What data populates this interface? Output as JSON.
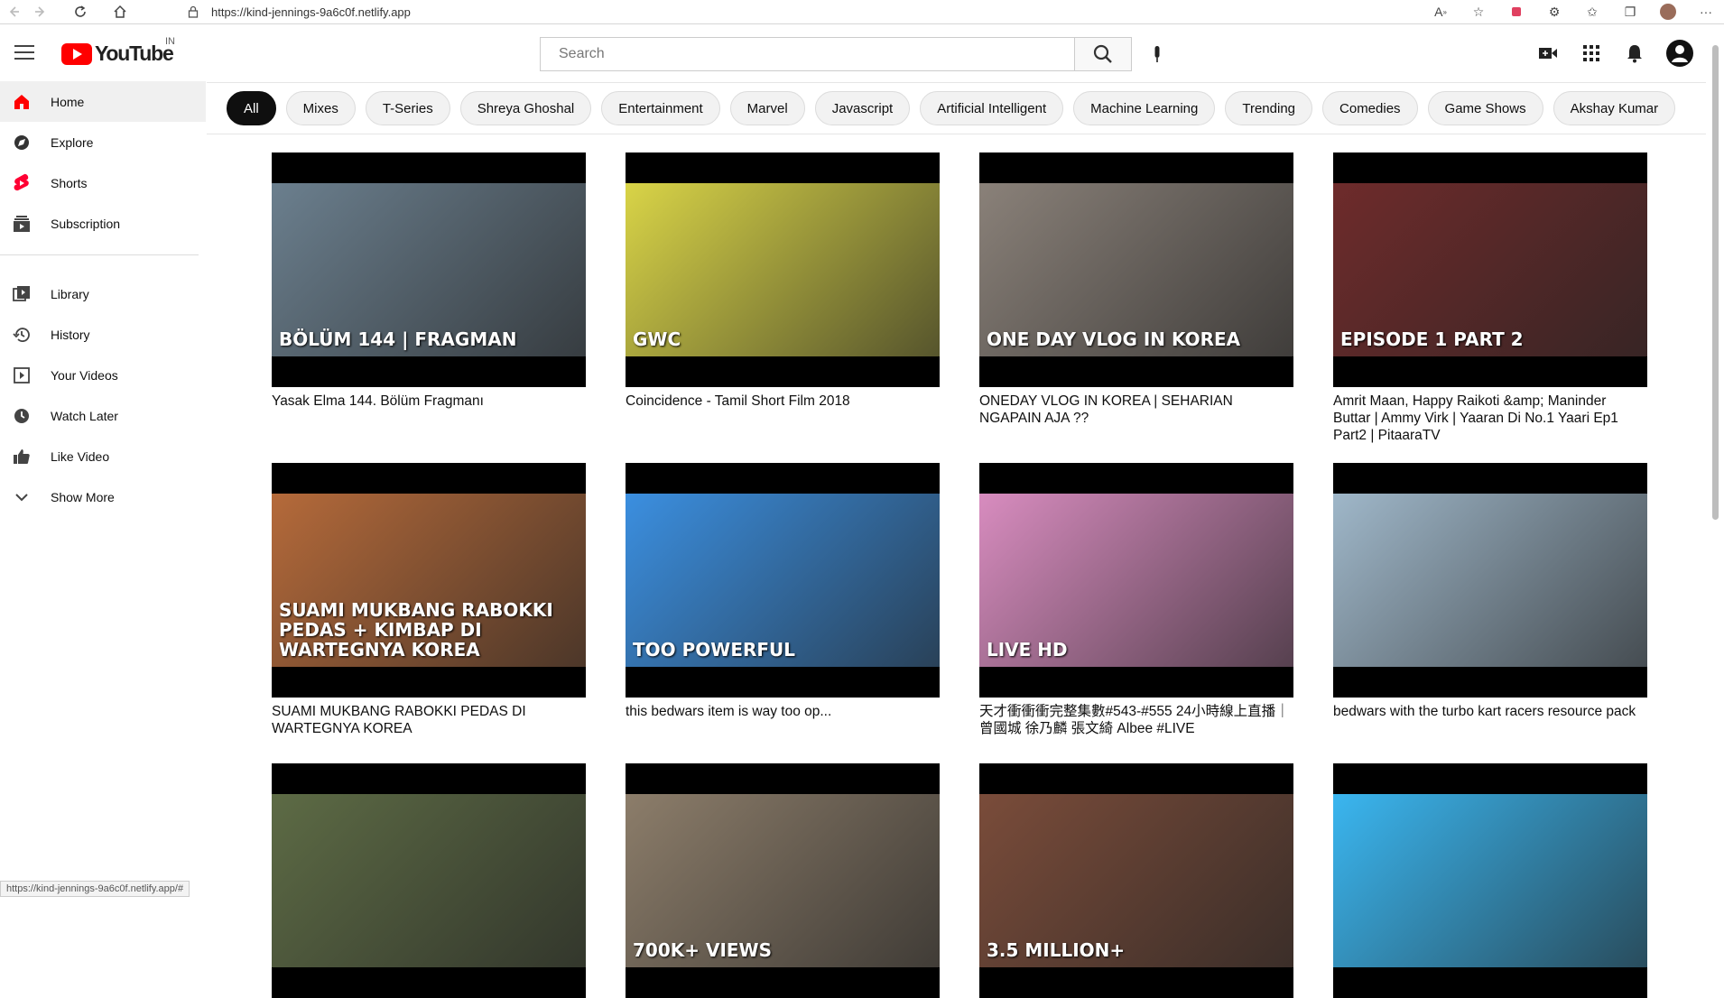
{
  "browser": {
    "url": "https://kind-jennings-9a6c0f.netlify.app",
    "status_url": "https://kind-jennings-9a6c0f.netlify.app/#"
  },
  "header": {
    "logo_text": "YouTube",
    "region": "IN",
    "search_placeholder": "Search"
  },
  "sidebar": {
    "primary": [
      {
        "label": "Home",
        "icon": "home-icon"
      },
      {
        "label": "Explore",
        "icon": "compass-icon"
      },
      {
        "label": "Shorts",
        "icon": "shorts-icon"
      },
      {
        "label": "Subscription",
        "icon": "subscriptions-icon"
      }
    ],
    "secondary": [
      {
        "label": "Library",
        "icon": "library-icon"
      },
      {
        "label": "History",
        "icon": "history-icon"
      },
      {
        "label": "Your Videos",
        "icon": "your-videos-icon"
      },
      {
        "label": "Watch Later",
        "icon": "clock-icon"
      },
      {
        "label": "Like Video",
        "icon": "thumbs-up-icon"
      },
      {
        "label": "Show More",
        "icon": "chevron-down-icon"
      }
    ]
  },
  "chips": [
    "All",
    "Mixes",
    "T-Series",
    "Shreya Ghoshal",
    "Entertainment",
    "Marvel",
    "Javascript",
    "Artificial Intelligent",
    "Machine Learning",
    "Trending",
    "Comedies",
    "Game Shows",
    "Akshay Kumar"
  ],
  "videos": [
    {
      "title": "Yasak Elma 144. Bölüm Fragmanı",
      "overlay": "BÖLÜM 144 | FRAGMAN",
      "color": "#6b7f8e"
    },
    {
      "title": "Coincidence - Tamil Short Film 2018",
      "overlay": "GWC",
      "color": "#d9d447"
    },
    {
      "title": "ONEDAY VLOG IN KOREA | SEHARIAN NGAPAIN AJA ??",
      "overlay": "ONE DAY VLOG IN KOREA",
      "color": "#8a8179"
    },
    {
      "title": "Amrit Maan, Happy Raikoti &amp; Maninder Buttar | Ammy Virk | Yaaran Di No.1 Yaari Ep1 Part2 | PitaaraTV",
      "overlay": "EPISODE 1 PART 2",
      "color": "#6e2b2b"
    },
    {
      "title": "SUAMI MUKBANG RABOKKI PEDAS DI WARTEGNYA KOREA",
      "overlay": "SUAMI MUKBANG RABOKKI PEDAS + KIMBAP DI WARTEGNYA KOREA",
      "color": "#b56a3a"
    },
    {
      "title": "this bedwars item is way too op...",
      "overlay": "TOO POWERFUL",
      "color": "#3b8fe0"
    },
    {
      "title": "天才衝衝衝完整集數#543-#555 24小時線上直播｜曾國城 徐乃麟 張文綺 Albee #LIVE",
      "overlay": "LIVE HD",
      "color": "#d88cbf"
    },
    {
      "title": "bedwars with the turbo kart racers resource pack",
      "overlay": "",
      "color": "#9fb7c9"
    },
    {
      "title": "",
      "overlay": "",
      "color": "#5d6b45"
    },
    {
      "title": "",
      "overlay": "700K+ VIEWS",
      "color": "#8c7d6a"
    },
    {
      "title": "",
      "overlay": "3.5 MILLION+",
      "color": "#7a4c3a"
    },
    {
      "title": "",
      "overlay": "",
      "color": "#3ab6f0"
    }
  ]
}
